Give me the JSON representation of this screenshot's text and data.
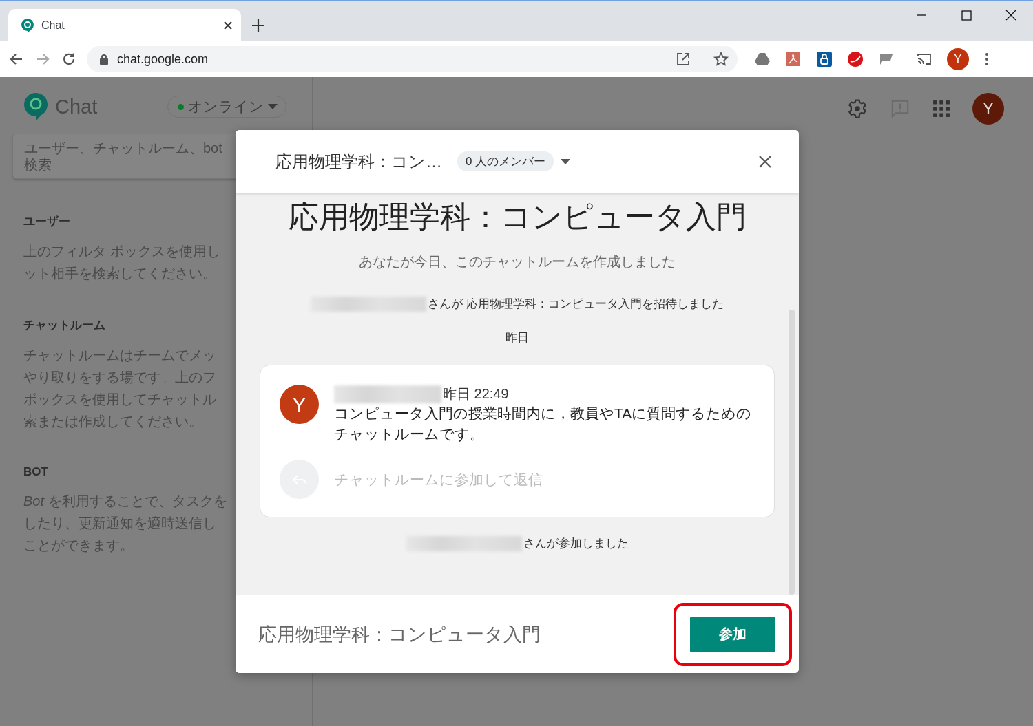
{
  "browser": {
    "tab": {
      "title": "Chat",
      "selected": true
    },
    "address": "chat.google.com",
    "profile_initial": "Y"
  },
  "app": {
    "logo_text": "Chat",
    "status": {
      "label": "オンライン",
      "online": true
    },
    "search": {
      "placeholder": "ユーザー、チャットルーム、bot\n検索"
    },
    "sections": [
      {
        "heading": "ユーザー",
        "lines": [
          "上のフィルタ ボックスを使用し",
          "ット相手を検索してください。"
        ]
      },
      {
        "heading": "チャットルーム",
        "lines": [
          "チャットルームはチームでメッ",
          "やり取りをする場です。上のフ",
          "ボックスを使用してチャットル",
          "索または作成してください。"
        ]
      },
      {
        "heading": "BOT",
        "lines": [
          "*Bot* を利用することで、タスクを",
          "したり、更新通知を適時送信し",
          "ことができます。"
        ]
      }
    ],
    "avatar_initial": "Y"
  },
  "dialog": {
    "header_title": "応用物理学科：コン…",
    "members": "0 人のメンバー",
    "room_title": "応用物理学科：コンピュータ入門",
    "created_note": "あなたが今日、このチャットルームを作成しました",
    "items": [
      {
        "kind": "event",
        "text": "さんが 応用物理学科：コンピュータ入門を招待しました"
      },
      {
        "kind": "date",
        "text": "昨日"
      },
      {
        "kind": "message",
        "avatar_initial": "Y",
        "time": "昨日 22:49",
        "text": "コンピュータ入門の授業時間内に，教員やTAに質問するためのチャットルームです。",
        "reply_placeholder": "チャットルームに参加して返信"
      },
      {
        "kind": "event",
        "text": "さんが参加しました"
      }
    ],
    "footer_title": "応用物理学科：コンピュータ入門",
    "join_button": "参加",
    "join_highlighted": true
  }
}
